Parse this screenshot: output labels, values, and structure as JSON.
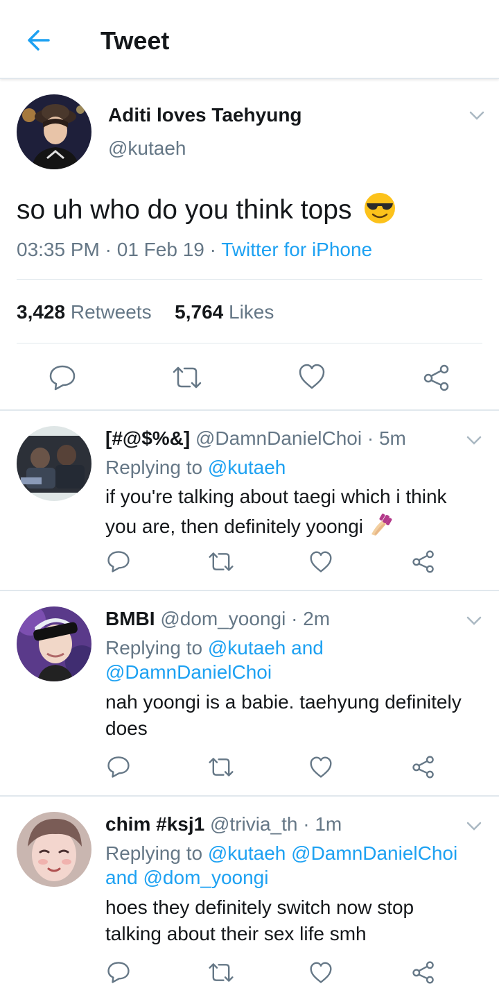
{
  "header": {
    "title": "Tweet",
    "back_icon": "arrow-left-icon"
  },
  "colors": {
    "accent": "#1da1f2",
    "secondary_text": "#657786",
    "divider": "#e1e8ed"
  },
  "tweet": {
    "name": "Aditi loves Taehyung",
    "handle": "@kutaeh",
    "text": "so uh who do you think tops",
    "emoji": "smiling-face-with-sunglasses",
    "time": "03:35 PM",
    "date": "01 Feb 19",
    "source": "Twitter for iPhone",
    "retweets_count": "3,428",
    "retweets_label": "Retweets",
    "likes_count": "5,764",
    "likes_label": "Likes"
  },
  "replies": [
    {
      "name": "[#@$%&]",
      "handle": "@DamnDanielChoi",
      "time": "5m",
      "replying_prefix": "Replying to",
      "replying_lines": [
        "@kutaeh"
      ],
      "text_lines": [
        "if you're talking about taegi which i think",
        "you are, then definitely yoongi"
      ],
      "emoji": "nail-polish"
    },
    {
      "name": "BMBI",
      "handle": "@dom_yoongi",
      "time": "2m",
      "replying_prefix": "Replying to",
      "replying_lines": [
        "@kutaeh and",
        "@DamnDanielChoi"
      ],
      "text_lines": [
        "nah yoongi is a babie. taehyung definitely",
        "does"
      ]
    },
    {
      "name": "chim #ksj1",
      "handle": "@trivia_th",
      "time": "1m",
      "replying_prefix": "Replying to",
      "replying_lines": [
        "@kutaeh @DamnDanielChoi",
        "and @dom_yoongi"
      ],
      "text_lines": [
        "hoes they definitely switch now stop",
        "talking about their sex life smh"
      ]
    }
  ]
}
